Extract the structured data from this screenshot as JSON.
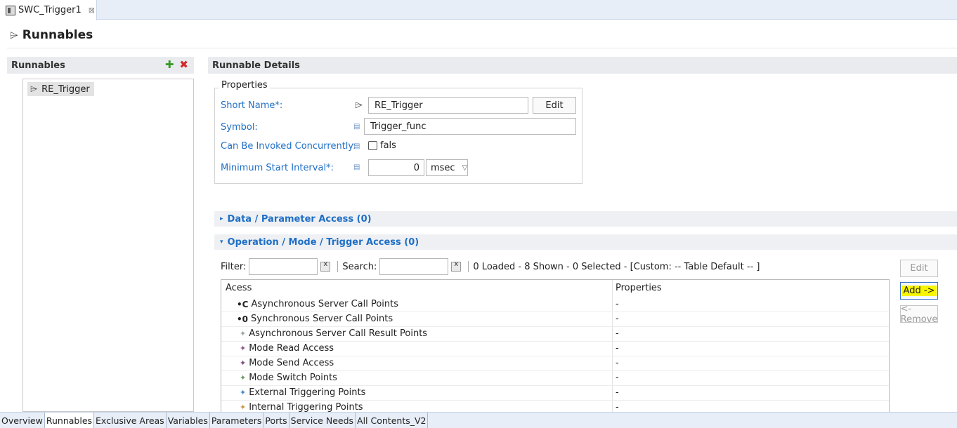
{
  "editor_tab": {
    "title": "SWC_Trigger1",
    "close": "⊠"
  },
  "page": {
    "title": "Runnables"
  },
  "left_panel": {
    "header": "Runnables",
    "add_icon": "plus-icon",
    "delete_icon": "delete-icon",
    "items": [
      {
        "label": "RE_Trigger"
      }
    ]
  },
  "details": {
    "header": "Runnable Details",
    "properties_legend": "Properties",
    "short_name_label": "Short Name*:",
    "short_name_value": "RE_Trigger",
    "edit_button": "Edit",
    "symbol_label": "Symbol:",
    "symbol_value": "Trigger_func",
    "concurrent_label": "Can Be Invoked Concurrently:",
    "concurrent_value": "false",
    "concurrent_value_visible": "fals",
    "min_interval_label": "Minimum Start Interval*:",
    "min_interval_value": "0",
    "min_interval_unit": "msec"
  },
  "data_access": {
    "label": "Data / Parameter Access (0)",
    "expanded": false
  },
  "operation_access": {
    "label": "Operation / Mode / Trigger Access (0)",
    "expanded": true
  },
  "filter": {
    "filter_label": "Filter:",
    "filter_value": "",
    "search_label": "Search:",
    "search_value": "",
    "status": "0 Loaded - 8 Shown - 0 Selected -  [Custom: -- Table Default -- ]"
  },
  "table": {
    "columns": [
      "Acess",
      "Properties"
    ],
    "rows": [
      {
        "icon": "async-call-icon",
        "glyph": "•C",
        "access": "Asynchronous Server Call Points",
        "properties": "-"
      },
      {
        "icon": "sync-call-icon",
        "glyph": "•0",
        "access": "Synchronous Server Call Points",
        "properties": "-"
      },
      {
        "icon": "async-result-icon",
        "glyph": "✦",
        "access": "Asynchronous Server Call Result Points",
        "properties": "-"
      },
      {
        "icon": "mode-read-icon",
        "glyph": "✦",
        "access": "Mode Read Access",
        "properties": "-"
      },
      {
        "icon": "mode-send-icon",
        "glyph": "✦",
        "access": "Mode Send Access",
        "properties": "-"
      },
      {
        "icon": "mode-switch-icon",
        "glyph": "✦",
        "access": "Mode Switch Points",
        "properties": "-"
      },
      {
        "icon": "external-trigger-icon",
        "glyph": "✦",
        "access": "External Triggering Points",
        "properties": "-"
      },
      {
        "icon": "internal-trigger-icon",
        "glyph": "✦",
        "access": "Internal Triggering Points",
        "properties": "-"
      }
    ]
  },
  "side_buttons": {
    "edit": "Edit",
    "add": "Add ->",
    "remove": "<- Remove"
  },
  "bottom_tabs": [
    "Overview",
    "Runnables",
    "Exclusive Areas",
    "Variables",
    "Parameters",
    "Ports",
    "Service Needs",
    "All Contents_V2"
  ],
  "active_bottom_tab": "Runnables",
  "colors": {
    "link_blue": "#1f6fc6",
    "highlight_yellow": "#f7f500",
    "tab_bar": "#e7eef8"
  }
}
